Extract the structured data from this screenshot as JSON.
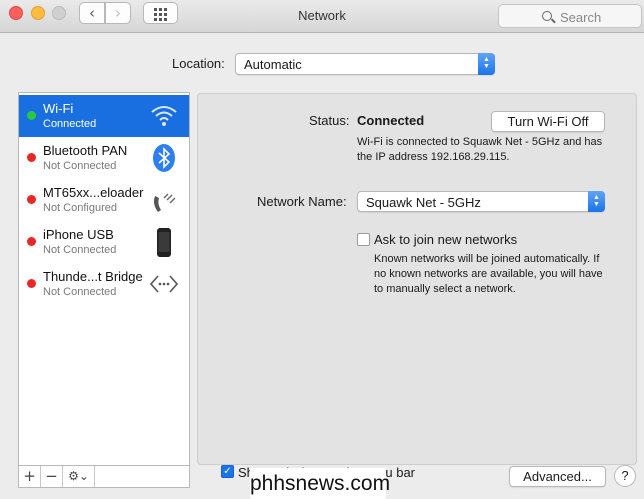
{
  "window": {
    "title": "Network"
  },
  "toolbar": {
    "back_glyph": "‹",
    "forward_glyph": "›",
    "search_placeholder": "Search",
    "icons": [
      "back-chevron-icon",
      "forward-chevron-icon",
      "show-all-grid-icon",
      "search-icon"
    ]
  },
  "location": {
    "label": "Location:",
    "value": "Automatic"
  },
  "services": [
    {
      "name": "Wi-Fi",
      "status": "Connected",
      "state_color": "#28c940",
      "selected": true,
      "icon": "wifi-icon"
    },
    {
      "name": "Bluetooth PAN",
      "status": "Not Connected",
      "state_color": "#ea2727",
      "icon": "bluetooth-icon"
    },
    {
      "name": "MT65xx...eloader",
      "status": "Not Configured",
      "state_color": "#ea2727",
      "icon": "modem-phone-icon"
    },
    {
      "name": "iPhone USB",
      "status": "Not Connected",
      "state_color": "#ea2727",
      "icon": "iphone-icon"
    },
    {
      "name": "Thunde...t Bridge",
      "status": "Not Connected",
      "state_color": "#ea2727",
      "icon": "bridge-arrows-icon"
    }
  ],
  "sidebar_actions": {
    "add": "+",
    "remove": "−",
    "gear": "⚙⌄"
  },
  "detail": {
    "status_label": "Status:",
    "status_value": "Connected",
    "turn_off_button": "Turn Wi-Fi Off",
    "status_description": "Wi-Fi is connected to Squawk Net - 5GHz and has the IP address 192.168.29.115.",
    "network_name_label": "Network Name:",
    "network_name_value": "Squawk Net - 5GHz",
    "ask_to_join_label": "Ask to join new networks",
    "ask_to_join_checked": false,
    "ask_to_join_description": "Known networks will be joined automatically. If no known networks are available, you will have to manually select a network."
  },
  "footer": {
    "show_status_label": "Show Wi-Fi status in menu bar",
    "show_status_checked": true,
    "checkmark": "✓",
    "advanced_button": "Advanced...",
    "help_button": "?"
  },
  "watermark": "phhsnews.com",
  "colors": {
    "selection": "#1a6fe0",
    "connected": "#28c940",
    "disconnected": "#ea2727",
    "accent": "#1a74ea"
  }
}
